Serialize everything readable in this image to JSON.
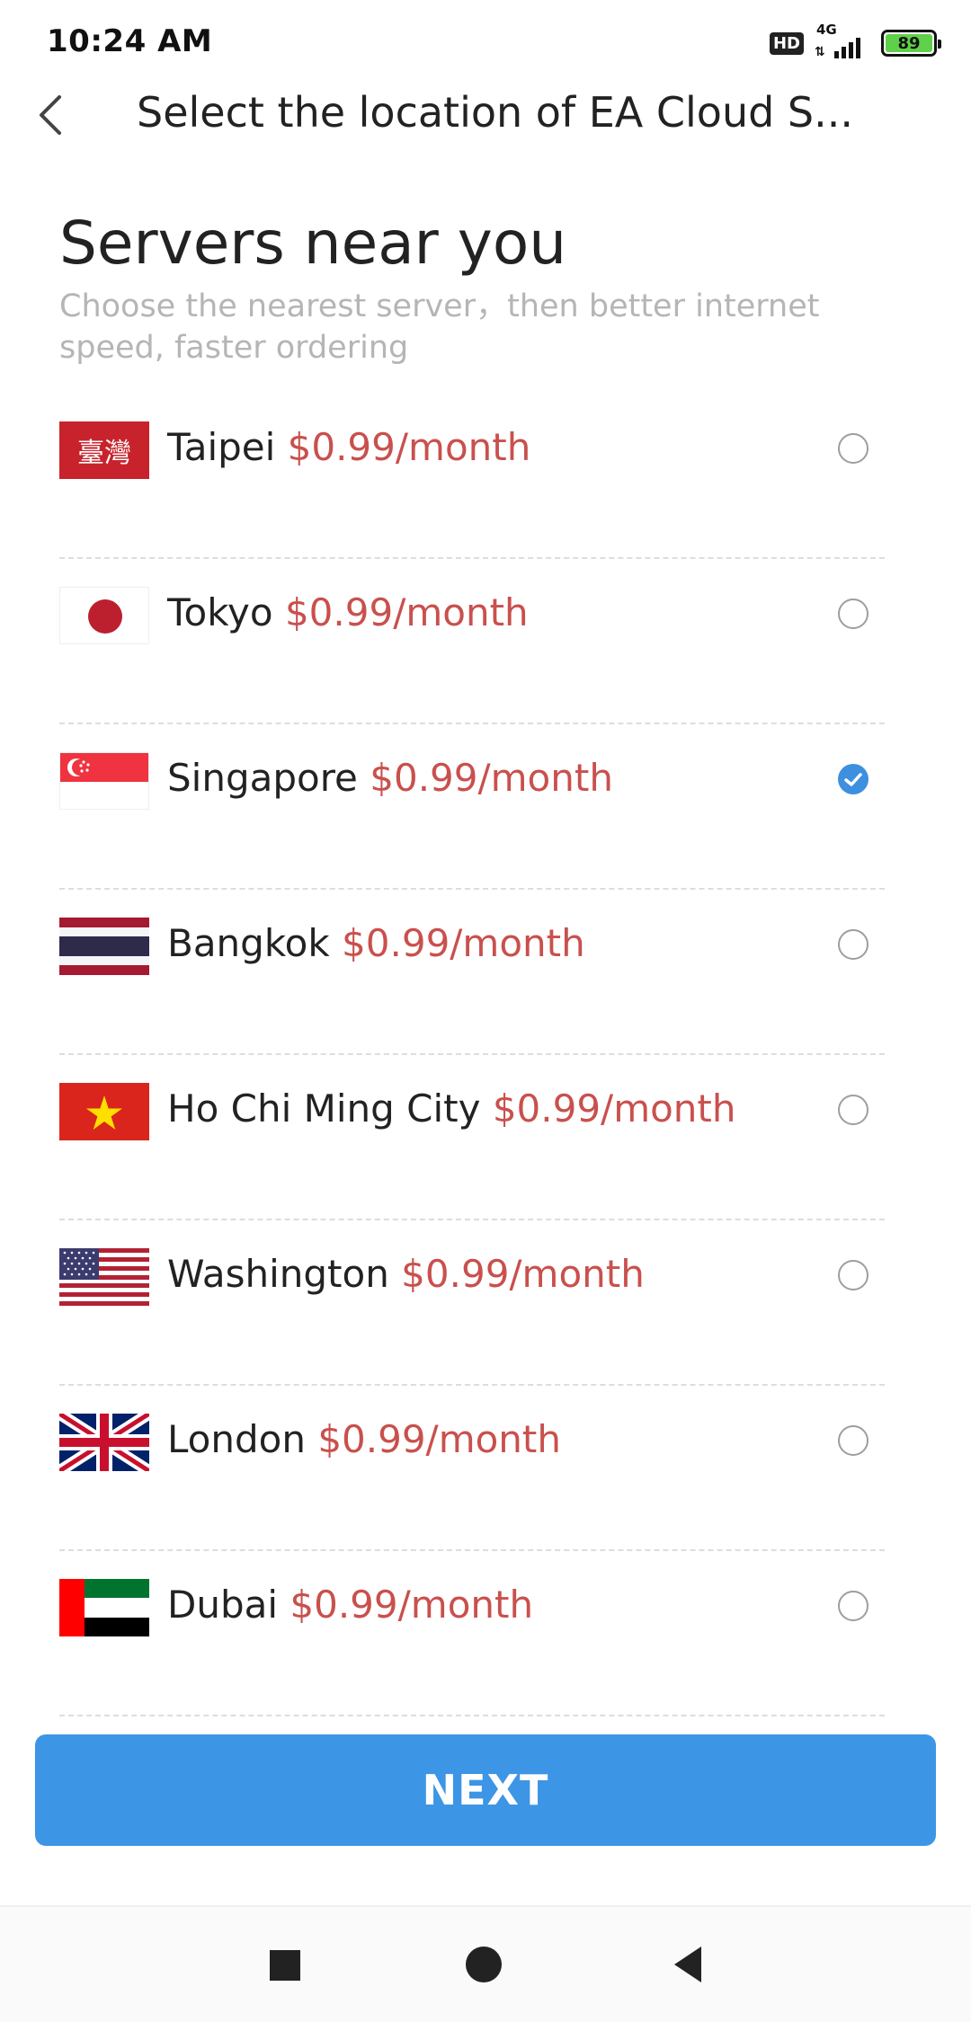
{
  "status_bar": {
    "time": "10:24 AM",
    "hd": "HD",
    "network": "4G",
    "battery": "89",
    "battery_color": "#5fd04a"
  },
  "header": {
    "title": "Select the location of EA Cloud S..."
  },
  "section": {
    "title": "Servers near you",
    "subtitle": "Choose the nearest server，then better internet speed, faster ordering"
  },
  "colors": {
    "price": "#c9504d",
    "accent": "#3d95e6",
    "radio_checked": "#3d8fe0"
  },
  "servers": [
    {
      "city": "Taipei",
      "price": "$0.99/month",
      "flag": "taiwan-flag",
      "flag_text": "臺灣",
      "selected": false
    },
    {
      "city": "Tokyo",
      "price": "$0.99/month",
      "flag": "japan-flag",
      "selected": false
    },
    {
      "city": "Singapore",
      "price": "$0.99/month",
      "flag": "singapore-flag",
      "selected": true
    },
    {
      "city": "Bangkok",
      "price": "$0.99/month",
      "flag": "thailand-flag",
      "selected": false
    },
    {
      "city": "Ho Chi Ming City",
      "price": "$0.99/month",
      "flag": "vietnam-flag",
      "selected": false
    },
    {
      "city": "Washington",
      "price": "$0.99/month",
      "flag": "usa-flag",
      "selected": false
    },
    {
      "city": "London",
      "price": "$0.99/month",
      "flag": "uk-flag",
      "selected": false
    },
    {
      "city": "Dubai",
      "price": "$0.99/month",
      "flag": "uae-flag",
      "selected": false
    }
  ],
  "button": {
    "next_label": "NEXT"
  },
  "nav": {
    "recents": "recents-icon",
    "home": "home-icon",
    "back": "back-icon"
  }
}
